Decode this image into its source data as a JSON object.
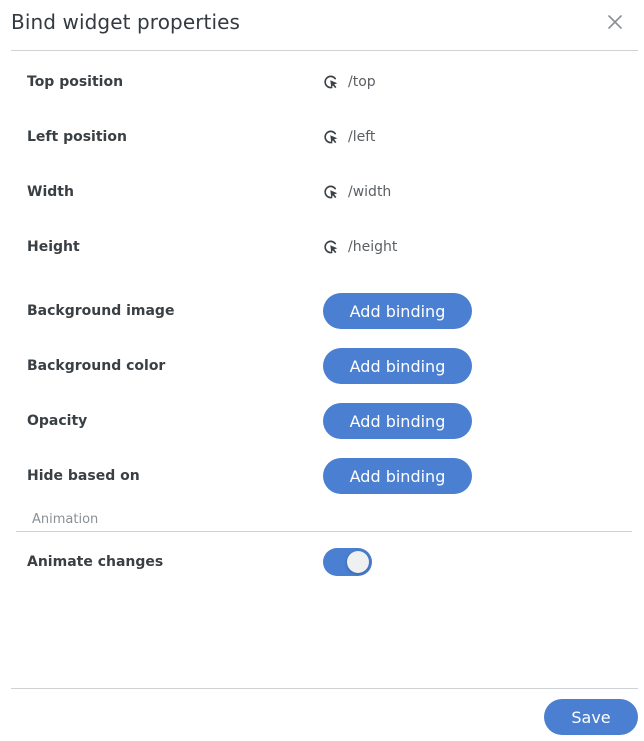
{
  "dialog": {
    "title": "Bind widget properties",
    "close_icon": "close-icon"
  },
  "bound_properties": [
    {
      "label": "Top position",
      "value": "/top",
      "icon": "binding-cursor-icon"
    },
    {
      "label": "Left position",
      "value": "/left",
      "icon": "binding-cursor-icon"
    },
    {
      "label": "Width",
      "value": "/width",
      "icon": "binding-cursor-icon"
    },
    {
      "label": "Height",
      "value": "/height",
      "icon": "binding-cursor-icon"
    }
  ],
  "unbound_properties": [
    {
      "label": "Background image",
      "button_label": "Add binding"
    },
    {
      "label": "Background color",
      "button_label": "Add binding"
    },
    {
      "label": "Opacity",
      "button_label": "Add binding"
    },
    {
      "label": "Hide based on",
      "button_label": "Add binding"
    }
  ],
  "animation": {
    "section_label": "Animation",
    "animate_changes_label": "Animate changes",
    "animate_changes_on": true
  },
  "footer": {
    "save_label": "Save"
  },
  "colors": {
    "accent": "#4a7fd1",
    "divider": "#cfd3d6",
    "label_text": "#3a3f44",
    "value_text": "#5a5f64",
    "section_text": "#8b9095"
  }
}
